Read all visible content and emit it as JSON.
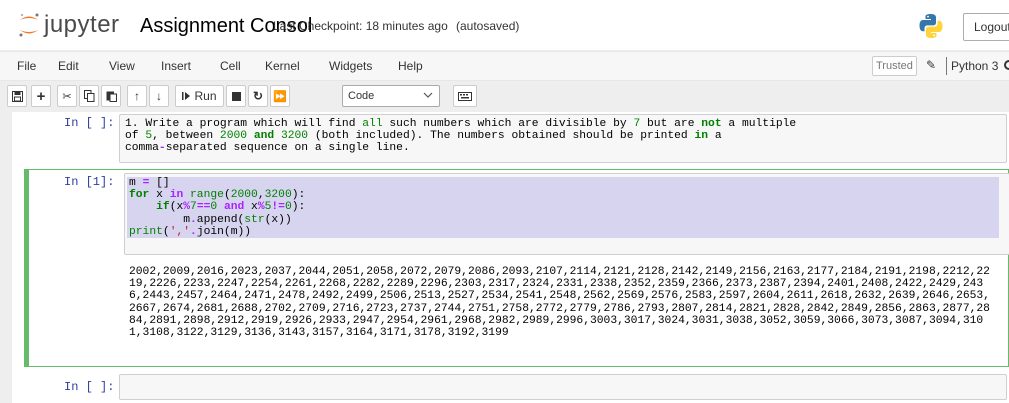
{
  "header": {
    "logo_text": "jupyter",
    "notebook_name": "Assignment Consol",
    "checkpoint": "Last Checkpoint: 18 minutes ago",
    "autosave": "(autosaved)",
    "logout_label": "Logout"
  },
  "menubar": {
    "items": [
      "File",
      "Edit",
      "View",
      "Insert",
      "Cell",
      "Kernel",
      "Widgets",
      "Help"
    ],
    "trusted": "Trusted",
    "kernel": "Python 3"
  },
  "toolbar": {
    "run_label": "Run",
    "cell_type": "Code"
  },
  "cells": [
    {
      "prompt": "In [ ]:",
      "type": "markdown-raw",
      "lines": [
        "1. Write a program which will find all such numbers which are divisible by 7 but are not a multiple",
        "of 5, between 2000 and 3200 (both included). The numbers obtained should be printed in a",
        "comma-separated sequence on a single line."
      ]
    },
    {
      "prompt": "In [1]:",
      "type": "code",
      "lines": [
        "m = []",
        "for x in range(2000,3200):",
        "    if(x%7==0 and x%5!=0):",
        "        m.append(str(x))",
        "print(','.join(m))"
      ],
      "output": [
        "2002,2009,2016,2023,2037,2044,2051,2058,2072,2079,2086,2093,2107,2114,2121,2128,2142,2149,2156,2163,2177,2184,2191,2198,2212,22",
        "19,2226,2233,2247,2254,2261,2268,2282,2289,2296,2303,2317,2324,2331,2338,2352,2359,2366,2373,2387,2394,2401,2408,2422,2429,243",
        "6,2443,2457,2464,2471,2478,2492,2499,2506,2513,2527,2534,2541,2548,2562,2569,2576,2583,2597,2604,2611,2618,2632,2639,2646,2653,",
        "2667,2674,2681,2688,2702,2709,2716,2723,2737,2744,2751,2758,2772,2779,2786,2793,2807,2814,2821,2828,2842,2849,2856,2863,2877,28",
        "84,2891,2898,2912,2919,2926,2933,2947,2954,2961,2968,2982,2989,2996,3003,3017,3024,3031,3038,3052,3059,3066,3073,3087,3094,310",
        "1,3108,3122,3129,3136,3143,3157,3164,3171,3178,3192,3199"
      ]
    },
    {
      "prompt": "In [ ]:",
      "type": "code",
      "lines": []
    }
  ],
  "colors": {
    "selected_cell_border": "#66bb6a",
    "prompt": "#303f9f",
    "keyword": "#008000",
    "selection": "#d7d4f0"
  }
}
